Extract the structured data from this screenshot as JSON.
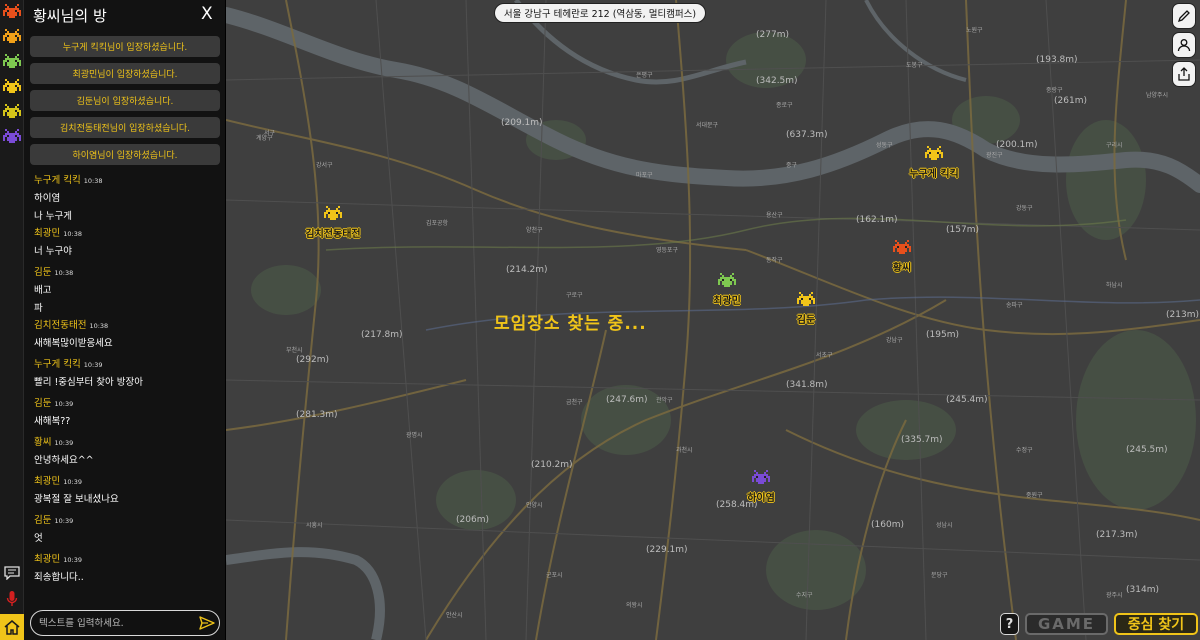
{
  "room": {
    "title": "황씨님의 방",
    "close_label": "X"
  },
  "notices": [
    "누구게 킥킥님이 입장하셨습니다.",
    "최광민님이 입장하셨습니다.",
    "김둔님이 입장하셨습니다.",
    "김치전동태전님이 입장하셨습니다.",
    "하이염님이 입장하셨습니다."
  ],
  "messages": [
    {
      "user": "누구게 킥킥",
      "time": "10:38",
      "lines": [
        "하이염",
        "나 누구게"
      ]
    },
    {
      "user": "최광민",
      "time": "10:38",
      "lines": [
        "너 누구야"
      ]
    },
    {
      "user": "김둔",
      "time": "10:38",
      "lines": [
        "배고",
        "파"
      ]
    },
    {
      "user": "김치전동태전",
      "time": "10:38",
      "lines": [
        "새해복많이받응세요"
      ]
    },
    {
      "user": "누구게 킥킥",
      "time": "10:39",
      "lines": [
        "빨리 !중심부터 찾아 방장아"
      ]
    },
    {
      "user": "김둔",
      "time": "10:39",
      "lines": [
        "새해복??"
      ]
    },
    {
      "user": "황씨",
      "time": "10:39",
      "lines": [
        "안녕하세요^^"
      ]
    },
    {
      "user": "최광민",
      "time": "10:39",
      "lines": [
        "광복절 잘 보내셨나요"
      ]
    },
    {
      "user": "김둔",
      "time": "10:39",
      "lines": [
        "엇"
      ]
    },
    {
      "user": "최광민",
      "time": "10:39",
      "lines": [
        "죄송합니다.."
      ]
    }
  ],
  "chat_input": {
    "placeholder": "텍스트를 입력하세요."
  },
  "map": {
    "address": "서울 강남구 테헤란로 212 (역삼동, 멀티캠퍼스)",
    "status": "모임장소 찾는 중...",
    "markers": [
      {
        "name": "누구게 킥킥",
        "color": "#f0c419",
        "icon": "space-invader-icon"
      },
      {
        "name": "김치전동태전",
        "color": "#f0c419",
        "icon": "space-invader-icon"
      },
      {
        "name": "황씨",
        "color": "#e8501c",
        "icon": "space-invader-icon"
      },
      {
        "name": "최광민",
        "color": "#7ec850",
        "icon": "space-invader-icon"
      },
      {
        "name": "김둔",
        "color": "#f0c419",
        "icon": "space-invader-icon"
      },
      {
        "name": "하이염",
        "color": "#7a4bd6",
        "icon": "space-invader-icon"
      }
    ],
    "district_labels": [
      "계양구",
      "서구",
      "강서구",
      "김포공항",
      "양천구",
      "구로구",
      "영등포구",
      "동작구",
      "관악구",
      "금천구",
      "부천시",
      "광명시",
      "마포구",
      "용산구",
      "서초구",
      "강남구",
      "송파구",
      "강동구",
      "하남시",
      "성남시",
      "과천시",
      "안양시",
      "의왕시",
      "군포시",
      "시흥시",
      "안산시",
      "수정구",
      "중원구",
      "분당구",
      "수지구",
      "광주시",
      "도봉구",
      "노원구",
      "중랑구",
      "성동구",
      "광진구",
      "은평구",
      "서대문구",
      "종로구",
      "중구",
      "남양주시",
      "구리시"
    ],
    "distances": [
      "(342.5m)",
      "(261m)",
      "(209.1m)",
      "(637.3m)",
      "(193.8m)",
      "(277m)",
      "(162.1m)",
      "(200.1m)",
      "(213m)",
      "(195m)",
      "(341.8m)",
      "(247.6m)",
      "(281.3m)",
      "(292m)",
      "(214.2m)",
      "(217.8m)",
      "(335.7m)",
      "(245.5m)",
      "(217.3m)",
      "(160m)",
      "(258.4m)",
      "(229.1m)",
      "(245.4m)",
      "(210.2m)",
      "(157m)",
      "(206m)",
      "(314m)"
    ]
  },
  "buttons": {
    "help": "?",
    "game": "GAME",
    "find_center": "중심 찾기"
  },
  "colors": {
    "accent": "#f0c419",
    "map_bg": "#3f3f3f",
    "river": "#5e6468",
    "panel": "#121212"
  }
}
